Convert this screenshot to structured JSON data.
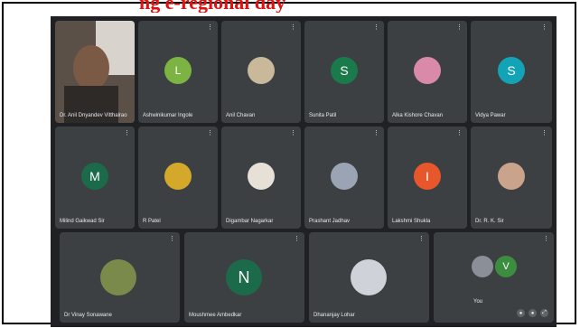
{
  "document": {
    "title": "ng e-regional day"
  },
  "colors": {
    "meet_bg": "#202124",
    "tile_bg": "#3c4043",
    "green": "#3c8d3f",
    "teal": "#12a4b6",
    "orange": "#e8572b"
  },
  "row1": [
    {
      "name": "Dr. Anil Dnyandev Vitthalrao",
      "kind": "camera"
    },
    {
      "name": "Ashwinikumar Ingole",
      "initial": "L",
      "color": "#7cb342",
      "kind": "avatar"
    },
    {
      "name": "Anil Chavan",
      "kind": "photo"
    },
    {
      "name": "Sunita Patil",
      "initial": "S",
      "color": "#1b7a4b",
      "kind": "avatar"
    },
    {
      "name": "Alka Kishore Chavan",
      "kind": "photo"
    },
    {
      "name": "Vidya Pawar",
      "initial": "S",
      "color": "#12a4b6",
      "kind": "avatar"
    }
  ],
  "row2": [
    {
      "name": "Milind Gaikwad Sir",
      "initial": "M",
      "color": "#1b6b4a",
      "kind": "avatar"
    },
    {
      "name": "R Patel",
      "kind": "photo"
    },
    {
      "name": "Digambar Nagarkar",
      "kind": "photo"
    },
    {
      "name": "Prashant Jadhav",
      "kind": "photo"
    },
    {
      "name": "Lakshmi Shukla",
      "initial": "I",
      "color": "#e8572b",
      "kind": "avatar"
    },
    {
      "name": "Dr. R. K. Sir",
      "kind": "photo"
    }
  ],
  "row3": [
    {
      "name": "Dr Vinay Sonawane",
      "kind": "photo"
    },
    {
      "name": "Moushmee Ambedkar",
      "initial": "N",
      "color": "#1b6b4a",
      "kind": "avatar"
    },
    {
      "name": "Dhananjay Lohar",
      "kind": "photo"
    },
    {
      "name": "You",
      "initial": "V",
      "color": "#3c8d3f",
      "kind": "self"
    }
  ],
  "more_icon": "⋮"
}
